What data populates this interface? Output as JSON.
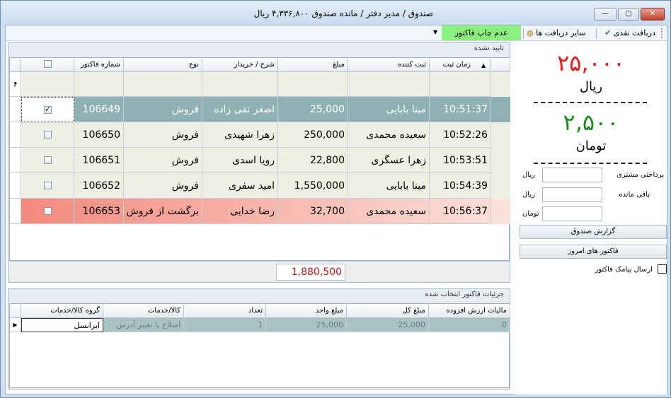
{
  "window": {
    "title": "صندوق / مدیر دفتر /  مانده صندوق ۴,۳۳۶,۸۰۰ ریال",
    "buttons": {
      "minimize": "—",
      "maximize": "▢",
      "close": "✕"
    }
  },
  "toolbar": {
    "cash_receive": "دریافت نقدی",
    "other_receives": "سایر دریافت ها",
    "no_print": "عدم چاپ فاکتور"
  },
  "top_group": {
    "title": "تایید نشده",
    "columns": [
      "شماره فاکتور",
      "نوع",
      "شرح / خریدار",
      "مبلغ",
      "ثبت کننده",
      "زمان ثبت"
    ],
    "rows": [
      {
        "invoice": "106649",
        "type": "فروش",
        "buyer": "اصغر تقی زاده",
        "amount": "25,000",
        "registrar": "مینا بابایی",
        "time": "10:51:37",
        "checked": true,
        "style": "selected"
      },
      {
        "invoice": "106650",
        "type": "فروش",
        "buyer": "زهرا شهیدی",
        "amount": "250,000",
        "registrar": "سعیده محمدی",
        "time": "10:52:26",
        "checked": false,
        "style": "normal"
      },
      {
        "invoice": "106651",
        "type": "فروش",
        "buyer": "رویا اسدی",
        "amount": "22,800",
        "registrar": "زهرا عسگری",
        "time": "10:53:51",
        "checked": false,
        "style": "normal"
      },
      {
        "invoice": "106652",
        "type": "فروش",
        "buyer": "امید سفری",
        "amount": "1,550,000",
        "registrar": "مینا بابایی",
        "time": "10:54:39",
        "checked": false,
        "style": "normal"
      },
      {
        "invoice": "106653",
        "type": "برگشت از فروش",
        "buyer": "رضا خدایی",
        "amount": "32,700",
        "registrar": "سعیده محمدی",
        "time": "10:56:37",
        "checked": false,
        "style": "return"
      }
    ],
    "total": "1,880,500"
  },
  "bottom_group": {
    "title": "جزئیات فاکتور انتخاب شده",
    "columns": [
      "گروه کالا/خدمات",
      "کالا/خدمات",
      "تعداد",
      "مبلغ واحد",
      "مبلغ کل",
      "مالیات ارزش افزوده"
    ],
    "row": {
      "group": "ایرانسل",
      "item": "اصلاح یا تغییر آدرس",
      "qty": "1",
      "unit_price": "25,000",
      "total": "25,000",
      "vat": "0"
    }
  },
  "summary": {
    "rial_amount": "۲۵,۰۰۰",
    "rial_label": "ریال",
    "toman_amount": "۲,۵۰۰",
    "toman_label": "تومان",
    "customer_payment_label": "پرداختی مشتری",
    "remaining_label": "باقی مانده",
    "unit_rial": "ریال",
    "unit_toman": "تومان",
    "cash_report_button": "گزارش صندوق",
    "today_invoices_button": "فاکتور های امروز",
    "send_sms_label": "ارسال پیامک فاکتور"
  },
  "colors": {
    "selected_row": "#8fb1b3",
    "return_row": "#f3877a",
    "amount_red": "#e51c1c",
    "amount_green": "#1a8a1a"
  }
}
